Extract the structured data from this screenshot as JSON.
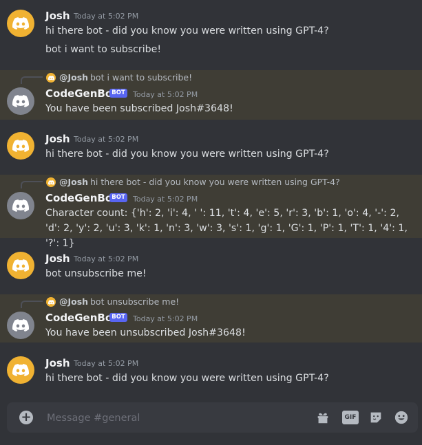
{
  "messages": [
    {
      "author": "Josh",
      "timestamp": "Today at 5:02 PM",
      "lines": [
        "hi there bot - did you know you were written using GPT-4?",
        "bot i want to subscribe!"
      ]
    },
    {
      "reply": {
        "author": "@Josh",
        "text": "bot i want to subscribe!"
      },
      "author": "CodeGenBot",
      "tag": "BOT",
      "timestamp": "Today at 5:02 PM",
      "text": "You have been subscribed Josh#3648!"
    },
    {
      "author": "Josh",
      "timestamp": "Today at 5:02 PM",
      "text": "hi there bot - did you know you were written using GPT-4?"
    },
    {
      "reply": {
        "author": "@Josh",
        "text": "hi there bot - did you know you were written using GPT-4?"
      },
      "author": "CodeGenBot",
      "tag": "BOT",
      "timestamp": "Today at 5:02 PM",
      "text": "Character count: {'h': 2, 'i': 4, ' ': 11, 't': 4, 'e': 5, 'r': 3, 'b': 1, 'o': 4, '-': 2, 'd': 2, 'y': 2, 'u': 3, 'k': 1, 'n': 3, 'w': 3, 's': 1, 'g': 1, 'G': 1, 'P': 1, 'T': 1, '4': 1, '?': 1}"
    },
    {
      "author": "Josh",
      "timestamp": "Today at 5:02 PM",
      "text": "bot unsubscribe me!"
    },
    {
      "reply": {
        "author": "@Josh",
        "text": "bot unsubscribe me!"
      },
      "author": "CodeGenBot",
      "tag": "BOT",
      "timestamp": "Today at 5:02 PM",
      "text": "You have been unsubscribed Josh#3648!"
    },
    {
      "author": "Josh",
      "timestamp": "Today at 5:02 PM",
      "text": "hi there bot - did you know you were written using GPT-4?"
    }
  ],
  "composer": {
    "placeholder": "Message #general",
    "gif_label": "GIF"
  },
  "icons": [
    "discord-logo-icon",
    "plus-icon",
    "gift-icon",
    "gif-icon",
    "sticker-icon",
    "emoji-icon"
  ],
  "colors": {
    "background": "#313338",
    "highlight": "#3f3d35",
    "bot_tag": "#5865f2",
    "avatar_user": "#f0b232",
    "avatar_bot": "#80848e"
  }
}
